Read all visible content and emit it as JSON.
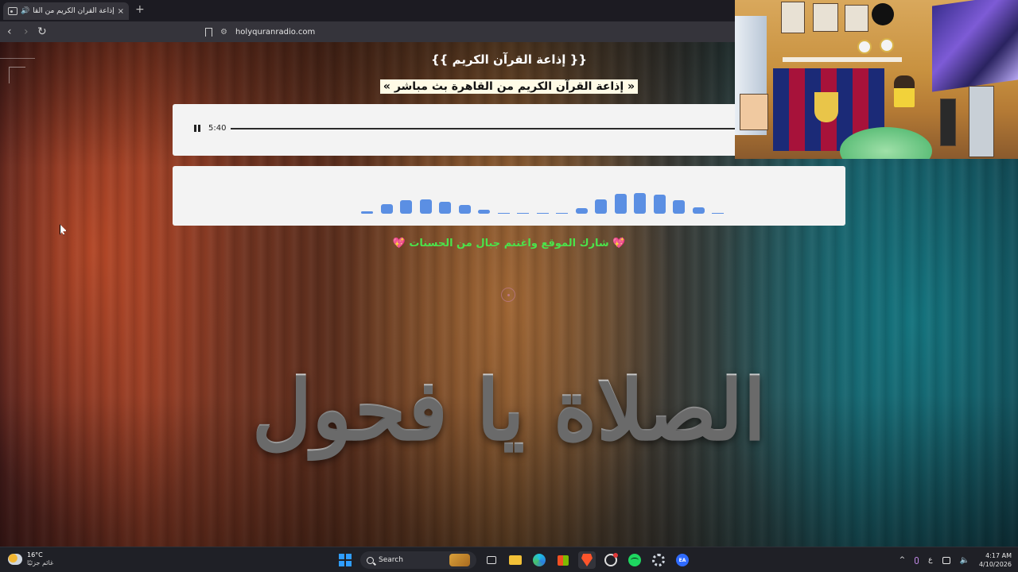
{
  "browser": {
    "tab_title": "إذاعة القرآن الكريم من القاهرة",
    "new_tab": "+",
    "close": "×",
    "speaker": "🔊",
    "url": "holyquranradio.com",
    "back": "‹",
    "forward": "›",
    "reload": "↻",
    "site_info": "⚙"
  },
  "page": {
    "heading": "{{ إذاعة القرآن الكريم }}",
    "subheading": "« إذاعة القرآن الكريم من القاهرة بث مباشر »",
    "share_text": "شارك الموقع واغتنم جبال من الحسنات",
    "heart": "💖",
    "calligraphy": "الصلاة يا فحول"
  },
  "player": {
    "state": "playing",
    "time": "5:40"
  },
  "visualizer": {
    "color": "#5b8fe3",
    "levels": [
      0.08,
      0.3,
      0.42,
      0.45,
      0.38,
      0.28,
      0.12,
      0.04,
      0.03,
      0.03,
      0.03,
      0.18,
      0.45,
      0.62,
      0.65,
      0.6,
      0.42,
      0.2,
      0.03
    ]
  },
  "taskbar": {
    "weather_temp": "16°C",
    "weather_desc": "غائم جزئيًا",
    "search_label": "Search",
    "lang": "ع",
    "time": "4:17 AM",
    "date": "4/10/2026",
    "chevron": "^",
    "volume": "🔈",
    "ea_label": "EA"
  }
}
